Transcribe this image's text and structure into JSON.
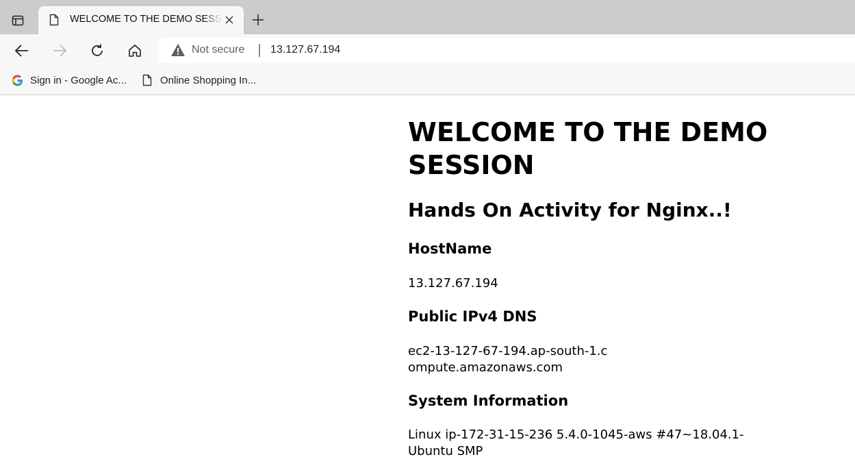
{
  "browser": {
    "tab": {
      "title": "WELCOME TO THE DEMO SESSION"
    },
    "address_bar": {
      "security_label": "Not secure",
      "url": "13.127.67.194"
    },
    "bookmarks": [
      {
        "label": "Sign in - Google Ac...",
        "icon": "google-icon"
      },
      {
        "label": "Online Shopping In...",
        "icon": "page-icon"
      }
    ]
  },
  "page": {
    "heading": "WELCOME TO THE DEMO SESSION",
    "subheading": "Hands On Activity for Nginx..!",
    "sections": [
      {
        "title": "HostName",
        "value": "13.127.67.194"
      },
      {
        "title": "Public IPv4 DNS",
        "value": "ec2-13-127-67-194.ap-south-1.compute.amazonaws.com"
      },
      {
        "title": "System Information",
        "value": "Linux ip-172-31-15-236 5.4.0-1045-aws #47~18.04.1-Ubuntu SMP"
      }
    ]
  },
  "colors": {
    "tab_strip": "#cccccc",
    "toolbar": "#f7f7f7",
    "warning_icon": "#5f5f5f"
  }
}
